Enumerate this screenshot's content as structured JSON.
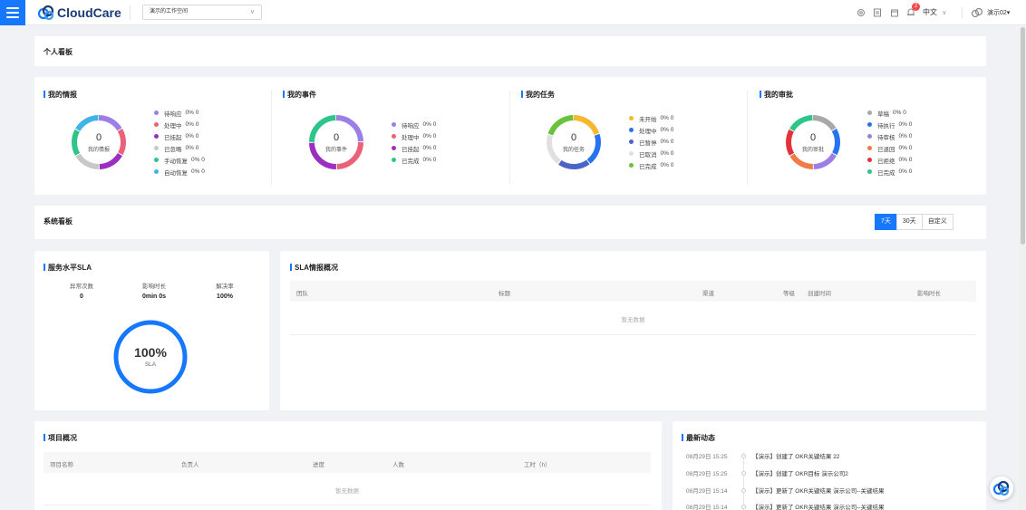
{
  "header": {
    "brand": "CloudCare",
    "workspace": "演示的工作空间",
    "notif_count": "2",
    "language": "中文",
    "language_chevron": "∨",
    "user": "演示02",
    "user_chevron": "▾",
    "icons": [
      "settings-icon",
      "document-icon",
      "calendar-icon",
      "bell-icon"
    ]
  },
  "personal_board": {
    "title": "个人看板",
    "panels": [
      {
        "title": "我的情报",
        "center_value": "0",
        "center_label": "我的情报",
        "legend": [
          {
            "label": "待响应",
            "value": "0% 0",
            "color": "#9b7fe6"
          },
          {
            "label": "处理中",
            "value": "0% 0",
            "color": "#e9627a"
          },
          {
            "label": "已挂起",
            "value": "0% 0",
            "color": "#9b30c0"
          },
          {
            "label": "已忽略",
            "value": "0% 0",
            "color": "#c8c8c8"
          },
          {
            "label": "手动恢复",
            "value": "0% 0",
            "color": "#2ec58a"
          },
          {
            "label": "自动恢复",
            "value": "0% 0",
            "color": "#3eb5e5"
          }
        ]
      },
      {
        "title": "我的事件",
        "center_value": "0",
        "center_label": "我的事件",
        "legend": [
          {
            "label": "待响应",
            "value": "0% 0",
            "color": "#9b7fe6"
          },
          {
            "label": "处理中",
            "value": "0% 0",
            "color": "#e9627a"
          },
          {
            "label": "已挂起",
            "value": "0% 0",
            "color": "#9b30c0"
          },
          {
            "label": "已完成",
            "value": "0% 0",
            "color": "#2ec58a"
          }
        ]
      },
      {
        "title": "我的任务",
        "center_value": "0",
        "center_label": "我的任务",
        "legend": [
          {
            "label": "未开始",
            "value": "0% 0",
            "color": "#f5b82e"
          },
          {
            "label": "处理中",
            "value": "0% 0",
            "color": "#2773f0"
          },
          {
            "label": "已暂停",
            "value": "0% 0",
            "color": "#4a64c8"
          },
          {
            "label": "已取消",
            "value": "0% 0",
            "color": "#e0e0e0"
          },
          {
            "label": "已完成",
            "value": "0% 0",
            "color": "#68c23a"
          }
        ]
      },
      {
        "title": "我的审批",
        "center_value": "0",
        "center_label": "我的审批",
        "legend": [
          {
            "label": "草稿",
            "value": "0% 0",
            "color": "#a8a8a8"
          },
          {
            "label": "待执行",
            "value": "0% 0",
            "color": "#2773f0"
          },
          {
            "label": "待审核",
            "value": "0% 0",
            "color": "#9b7fe6"
          },
          {
            "label": "已退回",
            "value": "0% 0",
            "color": "#f07a48"
          },
          {
            "label": "已拒绝",
            "value": "0% 0",
            "color": "#e3323a"
          },
          {
            "label": "已完成",
            "value": "0% 0",
            "color": "#2ec58a"
          }
        ]
      }
    ]
  },
  "system_board": {
    "title": "系统看板",
    "ranges": [
      "7天",
      "30天",
      "自定义"
    ],
    "active_range": "7天"
  },
  "sla": {
    "title": "服务水平SLA",
    "stats": [
      {
        "label": "异常次数",
        "value": "0"
      },
      {
        "label": "影响时长",
        "value": "0min 0s"
      },
      {
        "label": "解决率",
        "value": "100%"
      }
    ],
    "gauge_value": "100%",
    "gauge_label": "SLA",
    "gauge_fraction": 1.0
  },
  "sla_info": {
    "title": "SLA情报概况",
    "columns": [
      "团队",
      "标题",
      "渠道",
      "等级",
      "创建时间",
      "影响时长"
    ],
    "empty_text": "暂无数据"
  },
  "project": {
    "title": "项目概况",
    "columns": [
      "项目名称",
      "负责人",
      "进度",
      "人数",
      "工时（h）"
    ],
    "empty_text": "暂无数据"
  },
  "activity": {
    "title": "最新动态",
    "items": [
      {
        "time": "08月29日 15:25",
        "text": "【演示】创建了 OKR关键结果 22"
      },
      {
        "time": "08月29日 15:25",
        "text": "【演示】创建了 OKR目标 演示公司2"
      },
      {
        "time": "08月29日 15:14",
        "text": "【演示】更新了 OKR关键结果 演示公司--关键结果"
      },
      {
        "time": "08月29日 15:14",
        "text": "【演示】更新了 OKR关键结果 演示公司--关键结果"
      }
    ]
  },
  "colors": {
    "accent": "#1677ff",
    "brand_text": "#1a3b73"
  }
}
